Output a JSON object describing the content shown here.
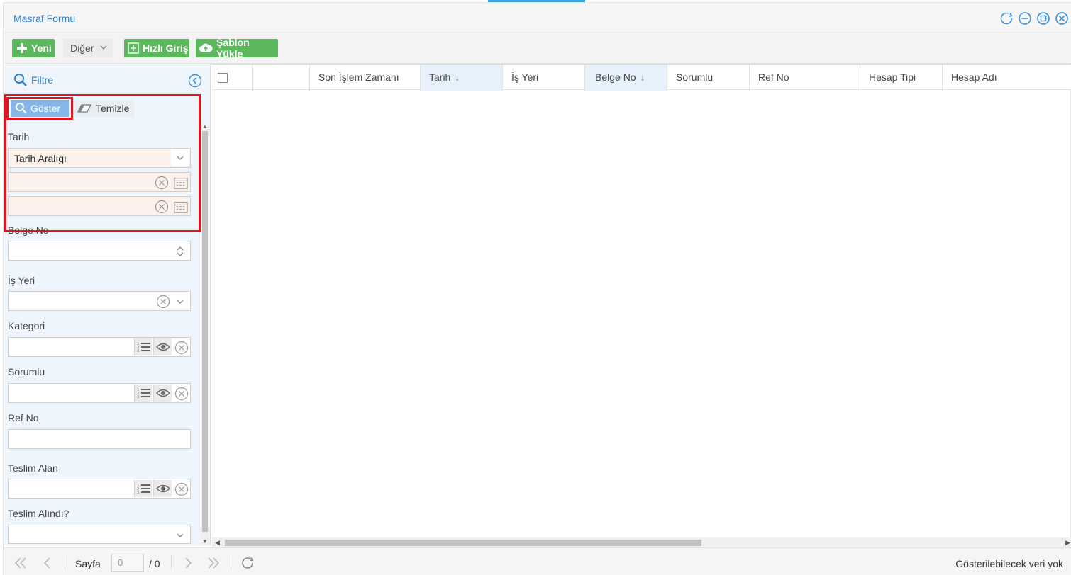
{
  "window": {
    "title": "Masraf Formu"
  },
  "toolbar": {
    "new_label": "Yeni",
    "other_label": "Diğer",
    "quick_entry_label": "Hızlı Giriş",
    "template_load_label": "Şablon Yükle"
  },
  "filter": {
    "title": "Filtre",
    "show_label": "Göster",
    "clear_label": "Temizle",
    "fields": {
      "date_label": "Tarih",
      "date_range_value": "Tarih Aralığı",
      "date_start_value": "",
      "date_end_value": "",
      "doc_no_label": "Belge No",
      "doc_no_value": "",
      "workplace_label": "İş Yeri",
      "workplace_value": "",
      "category_label": "Kategori",
      "category_value": "",
      "responsible_label": "Sorumlu",
      "responsible_value": "",
      "ref_no_label": "Ref No",
      "ref_no_value": "",
      "receiver_label": "Teslim Alan",
      "receiver_value": "",
      "received_label": "Teslim Alındı?",
      "received_value": ""
    }
  },
  "grid": {
    "columns": {
      "blank": "",
      "last_action_time": "Son İşlem Zamanı",
      "date": "Tarih",
      "workplace": "İş Yeri",
      "doc_no": "Belge No",
      "responsible": "Sorumlu",
      "ref_no": "Ref No",
      "account_type": "Hesap Tipi",
      "account_name": "Hesap Adı"
    },
    "sort_arrow": "↓"
  },
  "pager": {
    "page_label": "Sayfa",
    "page_value": "0",
    "total_pages": "/ 0",
    "status_text": "Gösterilebilecek veri yok"
  },
  "colors": {
    "accent_blue": "#2f7fc3",
    "green_button": "#5cb85c",
    "highlight_red": "#e0131e",
    "panel_bg": "#eef5fc"
  }
}
